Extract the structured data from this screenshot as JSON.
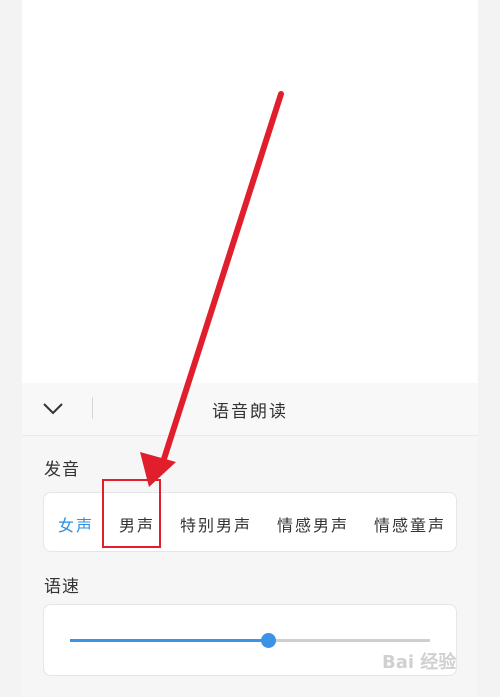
{
  "panel": {
    "title": "语音朗读",
    "collapse_icon": "chevron-down-icon"
  },
  "pronunciation": {
    "label": "发音",
    "options": [
      "女声",
      "男声",
      "特别男声",
      "情感男声",
      "情感童声"
    ],
    "selected": "女声",
    "highlighted": "男声"
  },
  "speed": {
    "label": "语速",
    "value_fraction": 0.55
  },
  "watermark": {
    "text": "Bai 经验"
  },
  "colors": {
    "accent": "#3b93e4",
    "annotation": "#e11e2b"
  }
}
